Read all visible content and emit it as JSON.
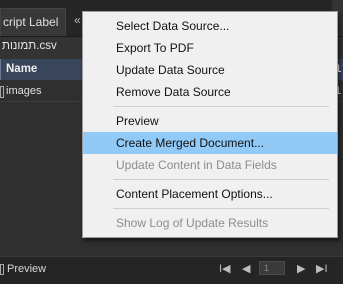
{
  "tabs": {
    "active_label": "cript Label",
    "arrows": "«"
  },
  "file": {
    "name": "תמונות.csv"
  },
  "table": {
    "header": {
      "name": "Name",
      "number": "1"
    },
    "rows": [
      {
        "label": "images",
        "number": "1"
      }
    ]
  },
  "bottom": {
    "preview_label": "Preview",
    "page": "1"
  },
  "menu": {
    "items": [
      {
        "label": "Select Data Source...",
        "enabled": true
      },
      {
        "label": "Export To PDF",
        "enabled": true
      },
      {
        "label": "Update Data Source",
        "enabled": true
      },
      {
        "label": "Remove Data Source",
        "enabled": true
      },
      {
        "label": "Preview",
        "enabled": true
      },
      {
        "label": "Create Merged Document...",
        "enabled": true,
        "highlighted": true
      },
      {
        "label": "Update Content in Data Fields",
        "enabled": false
      },
      {
        "label": "Content Placement Options...",
        "enabled": true
      },
      {
        "label": "Show Log of Update Results",
        "enabled": false
      }
    ]
  },
  "colors": {
    "menu_highlight": "#91c9f7",
    "header_row": "#39455a",
    "panel_bg": "#2f2f2f"
  }
}
